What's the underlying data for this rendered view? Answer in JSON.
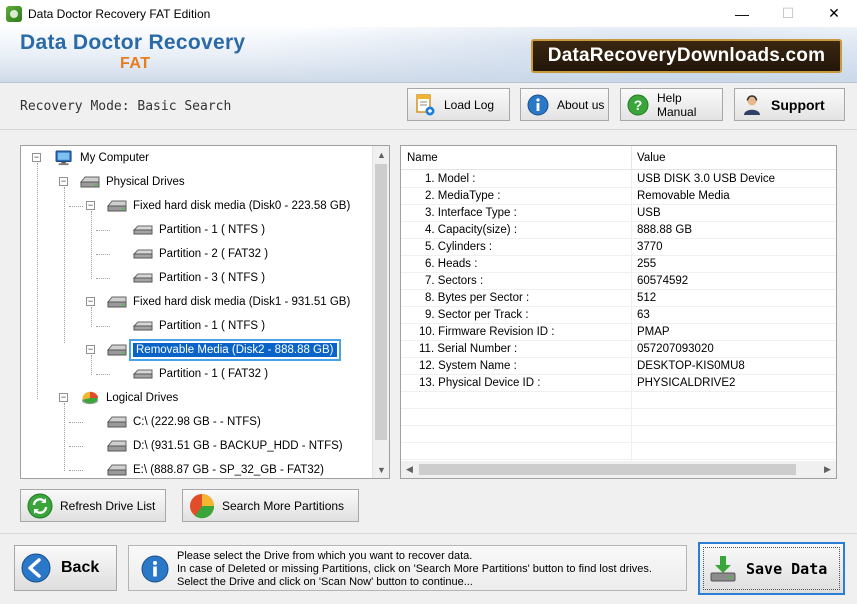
{
  "window": {
    "title": "Data Doctor Recovery FAT Edition",
    "minimize": "—",
    "maximize": "☐",
    "close": "✕"
  },
  "banner": {
    "title": "Data Doctor Recovery",
    "subtitle": "FAT",
    "site": "DataRecoveryDownloads.com"
  },
  "mode": {
    "label": "Recovery Mode: Basic Search"
  },
  "toolbar": {
    "load_log": "Load Log",
    "about_us": "About us",
    "help_manual": "Help Manual",
    "support": "Support"
  },
  "tree": {
    "my_computer": "My Computer",
    "physical_drives": "Physical Drives",
    "disk0": "Fixed hard disk media (Disk0 - 223.58 GB)",
    "disk0_p1": "Partition - 1 ( NTFS )",
    "disk0_p2": "Partition - 2 ( FAT32 )",
    "disk0_p3": "Partition - 3 ( NTFS )",
    "disk1": "Fixed hard disk media (Disk1 - 931.51 GB)",
    "disk1_p1": "Partition - 1 ( NTFS )",
    "disk2": "Removable Media (Disk2 - 888.88 GB)",
    "disk2_p1": "Partition - 1 ( FAT32 )",
    "logical_drives": "Logical Drives",
    "drive_c": "C:\\ (222.98 GB -  - NTFS)",
    "drive_d": "D:\\ (931.51 GB - BACKUP_HDD - NTFS)",
    "drive_e": "E:\\ (888.87 GB - SP_32_GB - FAT32)"
  },
  "details": {
    "col_name": "Name",
    "col_value": "Value",
    "rows": [
      {
        "name": "1. Model :",
        "value": "USB DISK 3.0 USB Device"
      },
      {
        "name": "2. MediaType :",
        "value": "Removable Media"
      },
      {
        "name": "3. Interface Type :",
        "value": "USB"
      },
      {
        "name": "4. Capacity(size) :",
        "value": "888.88 GB"
      },
      {
        "name": "5. Cylinders :",
        "value": "3770"
      },
      {
        "name": "6. Heads :",
        "value": "255"
      },
      {
        "name": "7. Sectors :",
        "value": "60574592"
      },
      {
        "name": "8. Bytes per Sector :",
        "value": "512"
      },
      {
        "name": "9. Sector per Track :",
        "value": "63"
      },
      {
        "name": "10. Firmware Revision ID :",
        "value": "PMAP"
      },
      {
        "name": "11. Serial Number :",
        "value": "057207093020"
      },
      {
        "name": "12. System Name :",
        "value": "DESKTOP-KIS0MU8"
      },
      {
        "name": "13. Physical Device ID :",
        "value": "PHYSICALDRIVE2"
      }
    ]
  },
  "actions": {
    "refresh": "Refresh Drive List",
    "search_more": "Search More Partitions"
  },
  "footer": {
    "back": "Back",
    "info_line1": "Please select the Drive from which you want to recover data.",
    "info_line2": "In case of Deleted or missing Partitions, click on 'Search More Partitions' button to find lost drives.",
    "info_line3": "Select the Drive and click on 'Scan Now' button to continue...",
    "save": "Save Data"
  },
  "colors": {
    "brand_blue": "#2a6aa8",
    "brand_orange": "#e67c1b",
    "selection": "#0a64c8"
  }
}
